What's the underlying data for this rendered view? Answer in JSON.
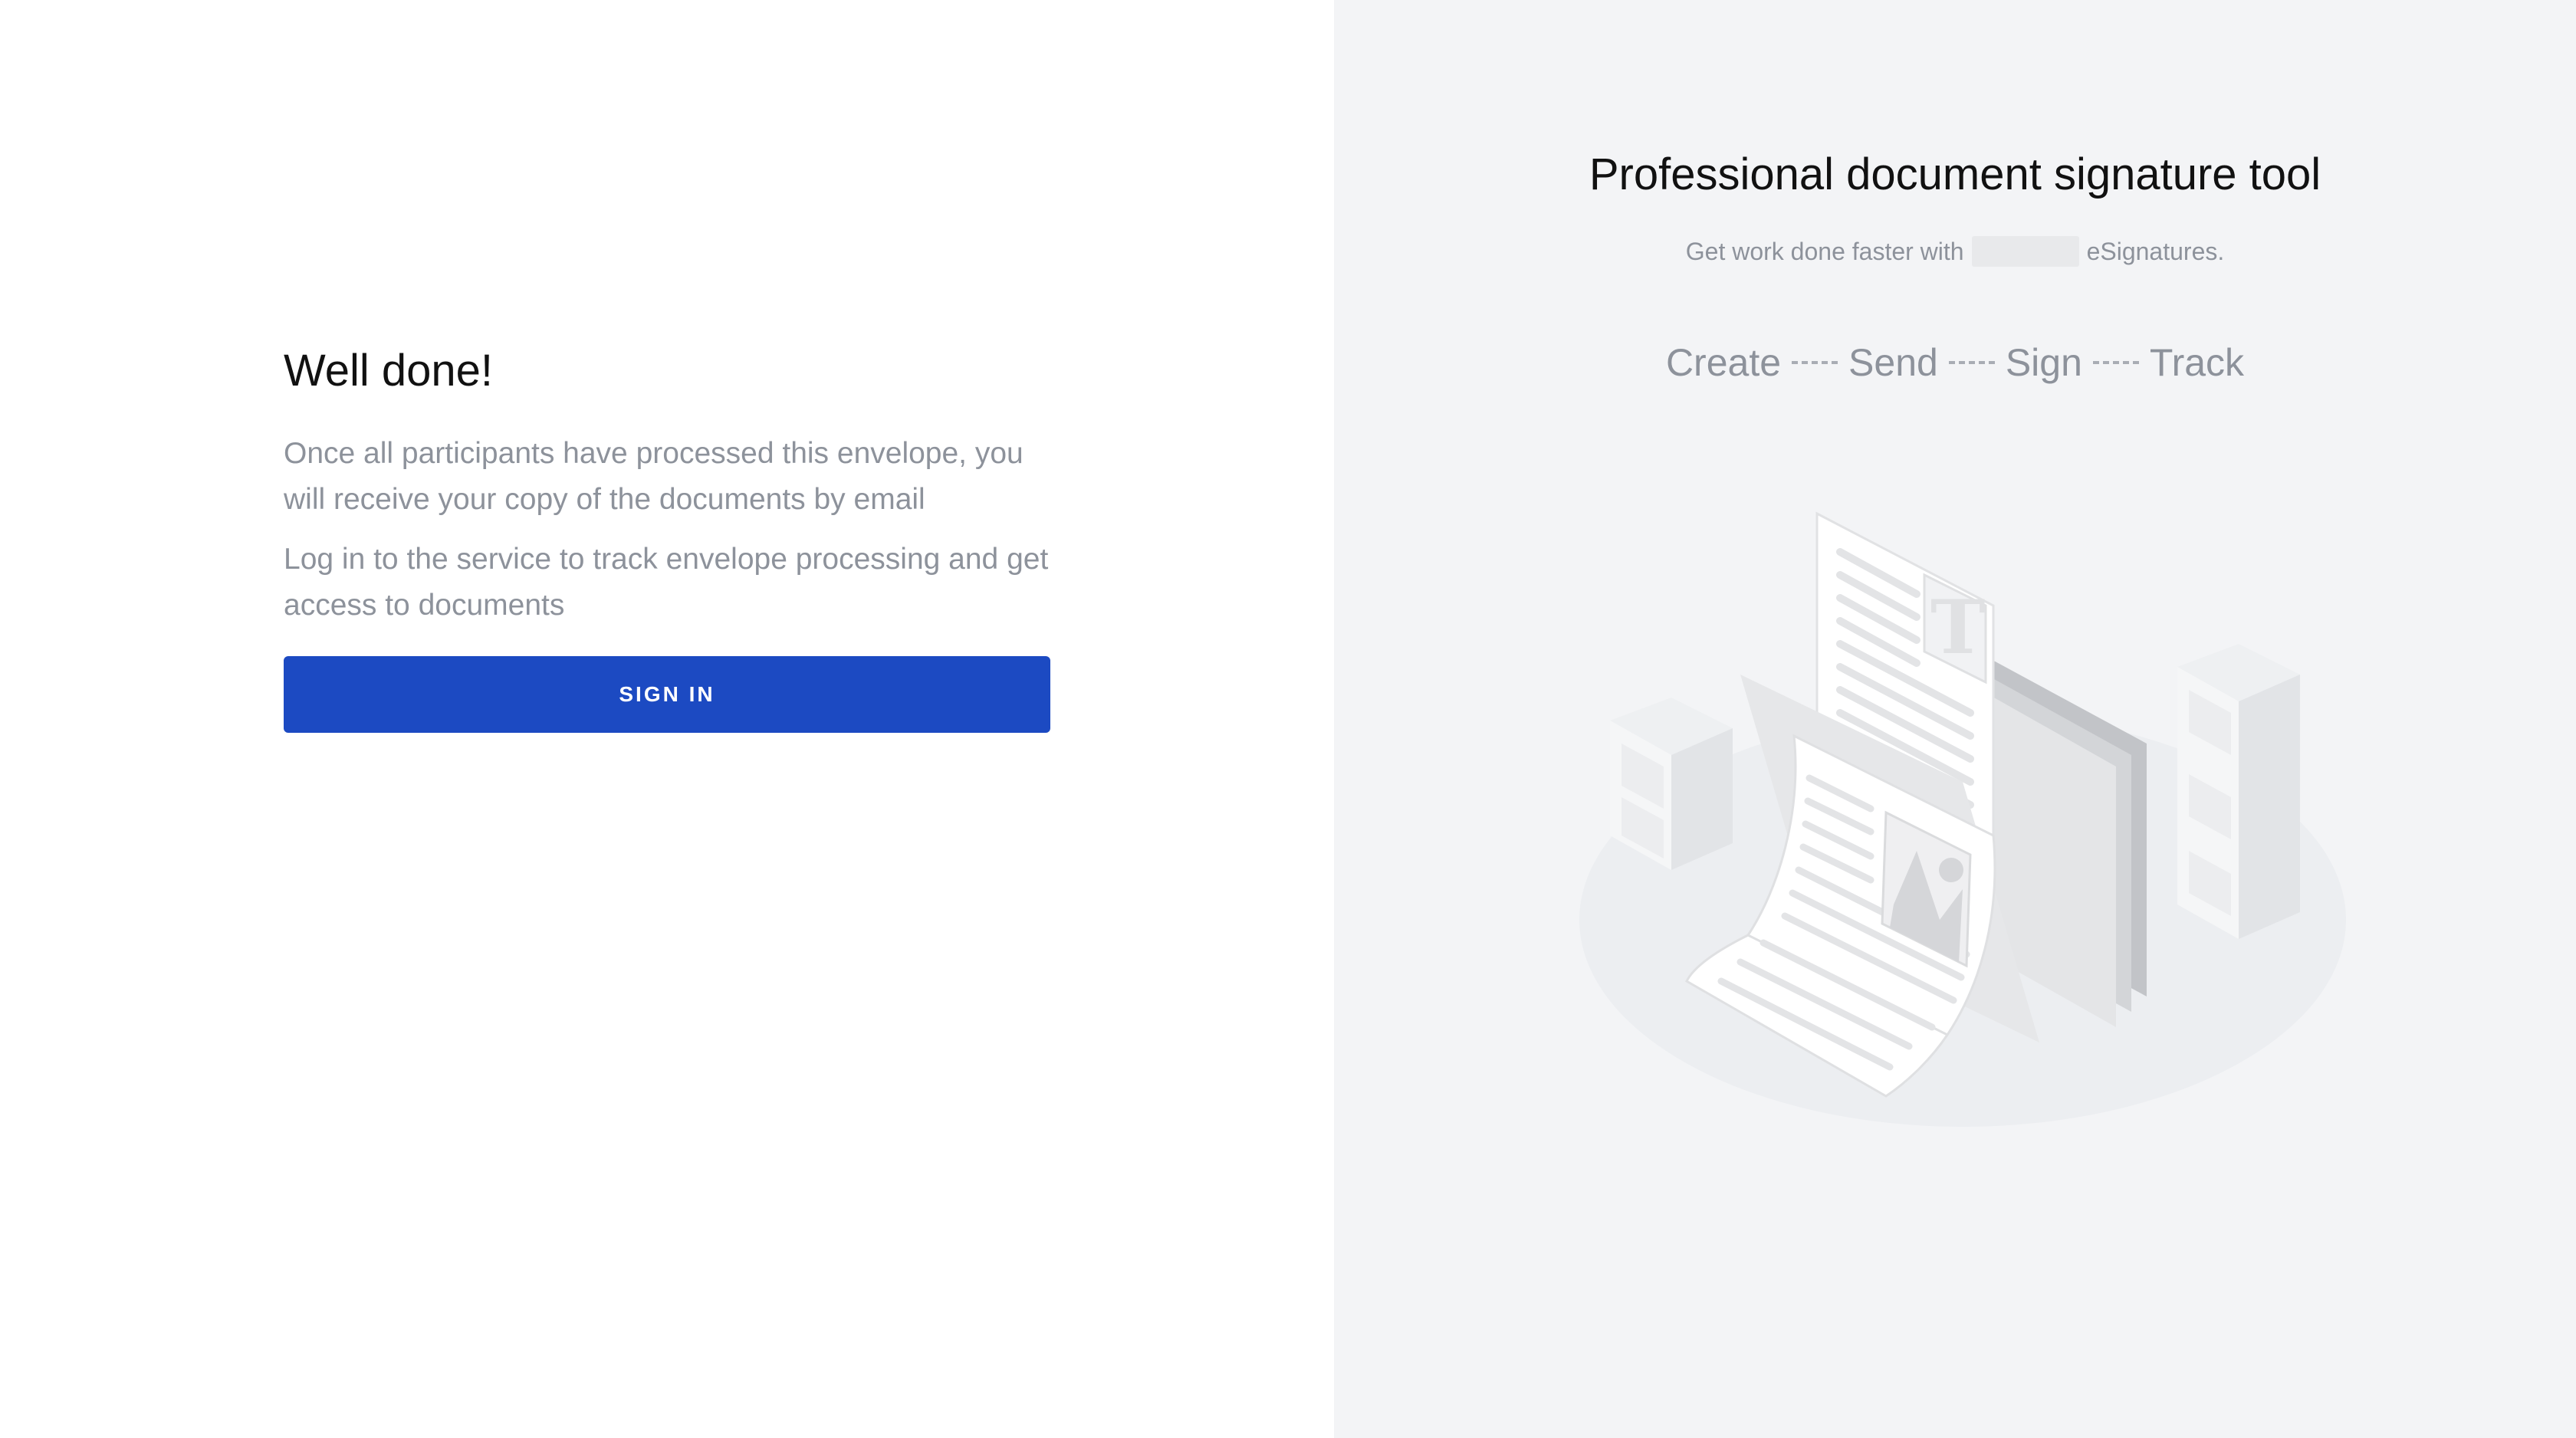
{
  "left": {
    "title": "Well done!",
    "paragraph1": "Once all participants have processed this envelope, you will receive your copy of the documents by email",
    "paragraph2": "Log in to the service to track envelope processing and get access to documents",
    "sign_in_label": "SIGN IN"
  },
  "right": {
    "title": "Professional document signature tool",
    "subtitle_before": "Get work done faster with",
    "subtitle_after": "eSignatures.",
    "steps": [
      "Create",
      "Send",
      "Sign",
      "Track"
    ],
    "illustration_icon": "documents-illustration"
  },
  "colors": {
    "accent": "#1c4ac2",
    "muted_text": "#8d929b",
    "right_bg": "#f3f4f6"
  }
}
